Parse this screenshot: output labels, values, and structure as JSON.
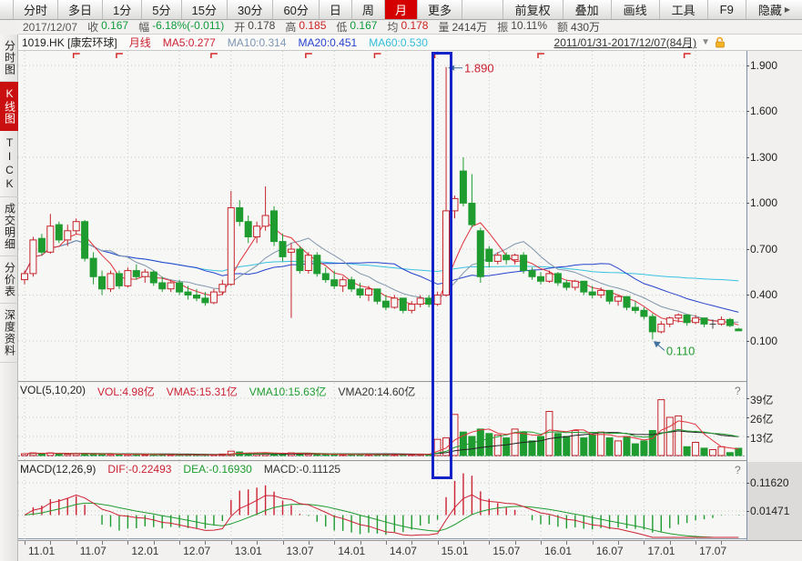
{
  "toolbar": {
    "tabs": [
      "分时",
      "多日",
      "1分",
      "5分",
      "15分",
      "30分",
      "60分",
      "日",
      "周",
      "月",
      "更多"
    ],
    "active_tab": "月",
    "right_buttons": [
      "前复权",
      "叠加",
      "画线",
      "工具",
      "F9",
      "隐藏"
    ],
    "hide_arrow": "▶"
  },
  "info": {
    "date": "2017/12/07",
    "pairs": [
      {
        "label": "收",
        "value": "0.167",
        "color": "#0f9a3c"
      },
      {
        "label": "幅",
        "value": "-6.18%(-0.011)",
        "color": "#0f9a3c"
      },
      {
        "label": "开",
        "value": "0.178",
        "color": "#444444"
      },
      {
        "label": "高",
        "value": "0.185",
        "color": "#cc2222"
      },
      {
        "label": "低",
        "value": "0.167",
        "color": "#0f9a3c"
      },
      {
        "label": "均",
        "value": "0.178",
        "color": "#cc2222"
      },
      {
        "label": "量",
        "value": "2414万",
        "color": "#444444"
      },
      {
        "label": "振",
        "value": "10.11%",
        "color": "#444444"
      },
      {
        "label": "额",
        "value": "430万",
        "color": "#444444"
      }
    ]
  },
  "sidebar": {
    "items": [
      {
        "label": "分时图"
      },
      {
        "label": "K线图"
      },
      {
        "label": "TICK"
      },
      {
        "label": "成交明细"
      },
      {
        "label": "分价表"
      },
      {
        "label": "深度资料"
      }
    ]
  },
  "price_header": {
    "symbol": "1019.HK [康宏环球]",
    "period": "月线",
    "period_color": "#cc2233",
    "ma5": "MA5:0.277",
    "ma5_color": "#cc2233",
    "ma10": "MA10:0.314",
    "ma10_color": "#7d96b4",
    "ma20": "MA20:0.451",
    "ma20_color": "#2643cc",
    "ma60": "MA60:0.530",
    "ma60_color": "#33bcd9",
    "range": "2011/01/31-2017/12/07(84月)",
    "dropdown_icon": "▼"
  },
  "vol_header": {
    "title": "VOL(5,10,20)",
    "vol": "VOL:4.98亿",
    "vol_color": "#cc2233",
    "vma5": "VMA5:15.31亿",
    "vma5_color": "#cc2233",
    "vma10": "VMA10:15.63亿",
    "vma10_color": "#1f9c30",
    "vma20": "VMA20:14.60亿",
    "vma20_color": "#333333"
  },
  "macd_header": {
    "title": "MACD(12,26,9)",
    "dif": "DIF:-0.22493",
    "dif_color": "#cc2233",
    "dea": "DEA:-0.16930",
    "dea_color": "#1f9c30",
    "macd": "MACD:-0.11125",
    "macd_color": "#333333"
  },
  "misc": {
    "help_icon": "?"
  },
  "chart_data": {
    "type": "candlestick",
    "symbol": "1019.HK 康宏环球",
    "period": "monthly",
    "months": 84,
    "range_start": "2011/01",
    "range_end": "2017/12",
    "grid_month_step": 6,
    "x_labels": [
      {
        "month": 0,
        "label": "11.01"
      },
      {
        "month": 6,
        "label": "11.07"
      },
      {
        "month": 12,
        "label": "12.01"
      },
      {
        "month": 18,
        "label": "12.07"
      },
      {
        "month": 24,
        "label": "13.01"
      },
      {
        "month": 30,
        "label": "13.07"
      },
      {
        "month": 36,
        "label": "14.01"
      },
      {
        "month": 42,
        "label": "14.07"
      },
      {
        "month": 48,
        "label": "15.01"
      },
      {
        "month": 54,
        "label": "15.07"
      },
      {
        "month": 60,
        "label": "16.01"
      },
      {
        "month": 66,
        "label": "16.07"
      },
      {
        "month": 72,
        "label": "17.01"
      },
      {
        "month": 78,
        "label": "17.07"
      }
    ],
    "price_axis": [
      {
        "label": "1.900",
        "value": 1.9
      },
      {
        "label": "1.600",
        "value": 1.6
      },
      {
        "label": "1.300",
        "value": 1.3
      },
      {
        "label": "1.000",
        "value": 1.0
      },
      {
        "label": "0.700",
        "value": 0.7
      },
      {
        "label": "0.400",
        "value": 0.4
      },
      {
        "label": "0.100",
        "value": 0.1
      }
    ],
    "vol_axis": [
      {
        "label": "39亿",
        "value": 39
      },
      {
        "label": "26亿",
        "value": 26
      },
      {
        "label": "13亿",
        "value": 13
      }
    ],
    "macd_axis": [
      {
        "label": "0.11620",
        "value": 0.1162
      },
      {
        "label": "0.01471",
        "value": 0.01471
      }
    ],
    "candles": [
      [
        0.5,
        0.56,
        0.47,
        0.54
      ],
      [
        0.54,
        0.78,
        0.52,
        0.76
      ],
      [
        0.77,
        0.8,
        0.66,
        0.68
      ],
      [
        0.68,
        0.93,
        0.67,
        0.85
      ],
      [
        0.86,
        0.88,
        0.74,
        0.76
      ],
      [
        0.76,
        0.86,
        0.72,
        0.82
      ],
      [
        0.82,
        0.9,
        0.8,
        0.88
      ],
      [
        0.88,
        0.89,
        0.62,
        0.64
      ],
      [
        0.64,
        0.68,
        0.47,
        0.52
      ],
      [
        0.52,
        0.56,
        0.4,
        0.44
      ],
      [
        0.44,
        0.56,
        0.42,
        0.54
      ],
      [
        0.54,
        0.56,
        0.44,
        0.46
      ],
      [
        0.46,
        0.58,
        0.45,
        0.56
      ],
      [
        0.56,
        0.6,
        0.5,
        0.52
      ],
      [
        0.52,
        0.57,
        0.48,
        0.55
      ],
      [
        0.55,
        0.56,
        0.46,
        0.48
      ],
      [
        0.48,
        0.52,
        0.42,
        0.44
      ],
      [
        0.44,
        0.5,
        0.42,
        0.48
      ],
      [
        0.48,
        0.5,
        0.4,
        0.42
      ],
      [
        0.42,
        0.46,
        0.37,
        0.4
      ],
      [
        0.4,
        0.44,
        0.36,
        0.38
      ],
      [
        0.38,
        0.42,
        0.33,
        0.35
      ],
      [
        0.35,
        0.44,
        0.34,
        0.42
      ],
      [
        0.42,
        0.5,
        0.4,
        0.47
      ],
      [
        0.47,
        1.08,
        0.46,
        0.97
      ],
      [
        0.97,
        1.02,
        0.85,
        0.88
      ],
      [
        0.88,
        0.92,
        0.74,
        0.78
      ],
      [
        0.78,
        0.88,
        0.74,
        0.85
      ],
      [
        0.85,
        1.11,
        0.82,
        0.92
      ],
      [
        0.95,
        0.98,
        0.72,
        0.75
      ],
      [
        0.75,
        0.8,
        0.62,
        0.65
      ],
      [
        0.68,
        0.74,
        0.25,
        0.7
      ],
      [
        0.7,
        0.72,
        0.54,
        0.56
      ],
      [
        0.56,
        0.68,
        0.54,
        0.66
      ],
      [
        0.66,
        0.68,
        0.52,
        0.54
      ],
      [
        0.54,
        0.58,
        0.48,
        0.5
      ],
      [
        0.5,
        0.56,
        0.44,
        0.46
      ],
      [
        0.46,
        0.52,
        0.42,
        0.5
      ],
      [
        0.5,
        0.52,
        0.42,
        0.44
      ],
      [
        0.44,
        0.48,
        0.38,
        0.4
      ],
      [
        0.4,
        0.46,
        0.36,
        0.44
      ],
      [
        0.44,
        0.44,
        0.34,
        0.36
      ],
      [
        0.36,
        0.4,
        0.3,
        0.32
      ],
      [
        0.32,
        0.4,
        0.31,
        0.38
      ],
      [
        0.38,
        0.38,
        0.28,
        0.3
      ],
      [
        0.3,
        0.36,
        0.28,
        0.34
      ],
      [
        0.34,
        0.4,
        0.32,
        0.38
      ],
      [
        0.38,
        0.4,
        0.32,
        0.34
      ],
      [
        0.34,
        0.42,
        0.33,
        0.4
      ],
      [
        0.4,
        1.89,
        0.39,
        0.95
      ],
      [
        0.95,
        1.05,
        0.9,
        1.03
      ],
      [
        1.21,
        1.3,
        0.98,
        1.0
      ],
      [
        1.0,
        1.19,
        0.84,
        0.86
      ],
      [
        0.82,
        0.84,
        0.48,
        0.52
      ],
      [
        0.7,
        0.72,
        0.58,
        0.62
      ],
      [
        0.62,
        0.68,
        0.6,
        0.66
      ],
      [
        0.66,
        0.68,
        0.6,
        0.63
      ],
      [
        0.63,
        0.67,
        0.6,
        0.66
      ],
      [
        0.66,
        0.68,
        0.54,
        0.56
      ],
      [
        0.56,
        0.58,
        0.5,
        0.52
      ],
      [
        0.52,
        0.55,
        0.47,
        0.49
      ],
      [
        0.49,
        0.56,
        0.48,
        0.54
      ],
      [
        0.54,
        0.55,
        0.46,
        0.48
      ],
      [
        0.48,
        0.5,
        0.43,
        0.45
      ],
      [
        0.45,
        0.5,
        0.43,
        0.49
      ],
      [
        0.49,
        0.49,
        0.4,
        0.42
      ],
      [
        0.42,
        0.46,
        0.38,
        0.4
      ],
      [
        0.4,
        0.45,
        0.38,
        0.43
      ],
      [
        0.43,
        0.43,
        0.34,
        0.36
      ],
      [
        0.36,
        0.4,
        0.33,
        0.39
      ],
      [
        0.39,
        0.39,
        0.3,
        0.32
      ],
      [
        0.32,
        0.36,
        0.28,
        0.3
      ],
      [
        0.3,
        0.32,
        0.24,
        0.26
      ],
      [
        0.26,
        0.28,
        0.11,
        0.16
      ],
      [
        0.16,
        0.23,
        0.15,
        0.21
      ],
      [
        0.21,
        0.26,
        0.19,
        0.25
      ],
      [
        0.25,
        0.28,
        0.22,
        0.27
      ],
      [
        0.27,
        0.27,
        0.2,
        0.22
      ],
      [
        0.22,
        0.27,
        0.21,
        0.25
      ],
      [
        0.25,
        0.25,
        0.19,
        0.21
      ],
      [
        0.21,
        0.24,
        0.18,
        0.21
      ],
      [
        0.21,
        0.26,
        0.2,
        0.24
      ],
      [
        0.24,
        0.25,
        0.19,
        0.2
      ],
      [
        0.178,
        0.185,
        0.167,
        0.167
      ]
    ],
    "volumes": [
      1.2,
      1.8,
      1.5,
      1.8,
      1.2,
      0.9,
      1.2,
      1.5,
      1.2,
      0.9,
      0.8,
      0.7,
      0.8,
      0.7,
      0.6,
      0.6,
      0.5,
      0.5,
      0.5,
      0.5,
      0.5,
      0.5,
      0.6,
      1.0,
      3.0,
      2.4,
      1.6,
      1.3,
      1.8,
      1.6,
      1.3,
      1.8,
      1.0,
      1.0,
      0.8,
      0.7,
      0.7,
      0.7,
      0.6,
      0.6,
      0.7,
      0.6,
      0.6,
      0.7,
      0.6,
      0.7,
      1.0,
      0.8,
      11,
      12,
      28,
      16,
      13,
      18,
      15,
      14,
      12,
      18,
      16,
      10,
      13,
      30,
      15,
      13,
      17,
      12,
      14,
      16,
      12,
      10,
      13,
      8,
      10,
      17,
      38,
      26,
      27,
      6,
      9,
      5,
      4,
      6,
      2,
      4.98
    ],
    "up_color": "#c5242b",
    "down_color": "#1f9c30",
    "doji_color": "#444444",
    "bg_color": "#f7f7f5",
    "grid_color": "#c9c9c5",
    "ma_colors": {
      "ma5": "#e0333c",
      "ma10": "#8095ac",
      "ma20": "#2643cc",
      "ma60": "#38c2e0"
    },
    "vma_colors": {
      "vma5": "#e0333c",
      "vma10": "#1f9c30",
      "vma20": "#222222"
    },
    "macd_colors": {
      "dif": "#cc2233",
      "dea": "#1f9c30",
      "hist_pos": "#cc2233",
      "hist_neg": "#1f9c30"
    },
    "annotations": [
      {
        "label": "1.890",
        "color": "#cc2233",
        "month": 49,
        "price": 1.89,
        "dir": "left"
      },
      {
        "label": "0.110",
        "color": "#1f9c30",
        "month": 73,
        "price": 0.11,
        "dir": "upleft"
      }
    ],
    "arrow_color": "#44729e",
    "highlight_box": {
      "from_month": 48,
      "to_month": 49,
      "color": "#1423c8"
    },
    "exright_marker_months": [
      6,
      11,
      22,
      33,
      41,
      48,
      60,
      77
    ]
  }
}
